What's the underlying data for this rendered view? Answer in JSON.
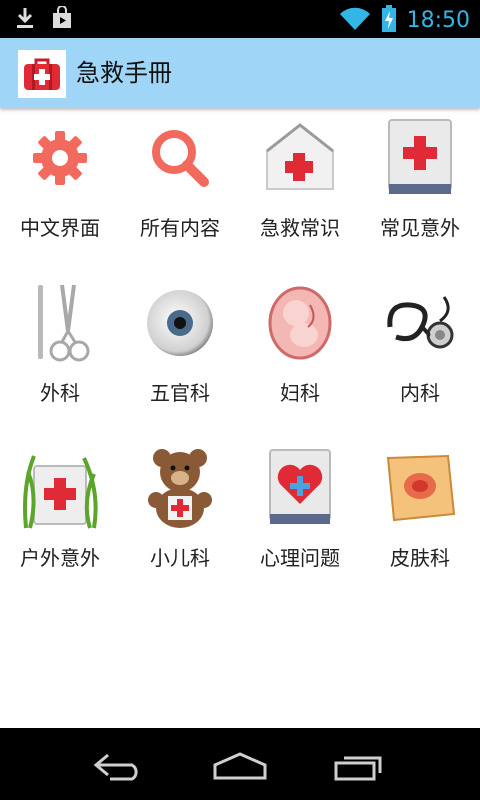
{
  "status_bar": {
    "time": "18:50",
    "icons": [
      "download-icon",
      "play-store-icon",
      "wifi-icon",
      "battery-charging-icon"
    ]
  },
  "app_bar": {
    "title": "急救手冊",
    "icon": "first-aid-kit-icon"
  },
  "grid": {
    "items": [
      {
        "label": "中文界面",
        "icon": "gear-icon"
      },
      {
        "label": "所有内容",
        "icon": "search-icon"
      },
      {
        "label": "急救常识",
        "icon": "first-aid-house-icon"
      },
      {
        "label": "常见意外",
        "icon": "first-aid-book-icon"
      },
      {
        "label": "外科",
        "icon": "scissors-scalpel-icon"
      },
      {
        "label": "五官科",
        "icon": "eyeball-icon"
      },
      {
        "label": "妇科",
        "icon": "fetus-icon"
      },
      {
        "label": "内科",
        "icon": "stethoscope-icon"
      },
      {
        "label": "户外意外",
        "icon": "grass-first-aid-icon"
      },
      {
        "label": "小儿科",
        "icon": "teddy-bear-icon"
      },
      {
        "label": "心理问题",
        "icon": "heart-book-icon"
      },
      {
        "label": "皮肤科",
        "icon": "skin-patch-icon"
      }
    ]
  },
  "nav_bar": {
    "buttons": [
      "back-icon",
      "home-icon",
      "recents-icon"
    ]
  },
  "colors": {
    "app_bar": "#9fd5f7",
    "accent_red": "#e8323c",
    "status_accent": "#33b5e5"
  }
}
